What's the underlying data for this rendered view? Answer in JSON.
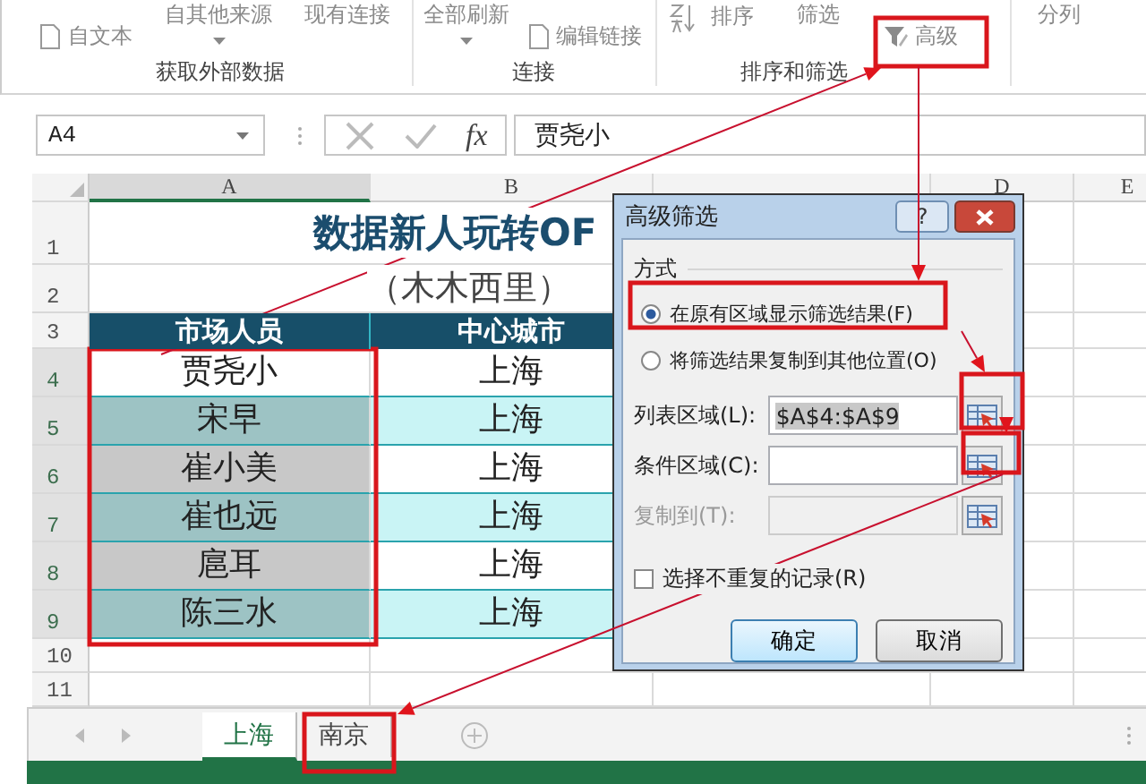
{
  "ribbon": {
    "groups": [
      {
        "label": "获取外部数据",
        "commands": [
          {
            "label": "自文本",
            "kind": "small"
          },
          {
            "label": "自其他来源",
            "kind": "large",
            "dropdown": true
          },
          {
            "label": "现有连接",
            "kind": "large",
            "dropdown": false
          }
        ]
      },
      {
        "label": "连接",
        "commands": [
          {
            "label": "全部刷新",
            "kind": "large",
            "dropdown": true
          },
          {
            "label": "编辑链接",
            "kind": "small"
          }
        ]
      },
      {
        "label": "排序和筛选",
        "commands": [
          {
            "label": "排序",
            "kind": "sort"
          },
          {
            "label": "筛选",
            "kind": "large",
            "dropdown": false
          },
          {
            "label": "高级",
            "kind": "small"
          }
        ]
      },
      {
        "commands": [
          {
            "label": "分列",
            "kind": "large",
            "dropdown": false
          }
        ]
      }
    ]
  },
  "formula_bar": {
    "name_box": "A4",
    "function_label": "fx",
    "formula": "贾尧小"
  },
  "columns": [
    {
      "label": "A",
      "selected": true
    },
    {
      "label": "B",
      "selected": false
    },
    {
      "label": "D",
      "selected": false
    },
    {
      "label": "E",
      "selected": false
    }
  ],
  "title_row": {
    "number": "1",
    "text": "数据新人玩转OF"
  },
  "subtitle_row": {
    "number": "2",
    "text": "（木木西里）"
  },
  "header_row": {
    "number": "3",
    "cells": [
      "市场人员",
      "中心城市"
    ]
  },
  "rows": [
    {
      "number": "4",
      "name": "贾尧小",
      "city": "上海",
      "selected": true,
      "active": true,
      "banded": false
    },
    {
      "number": "5",
      "name": "宋早",
      "city": "上海",
      "selected": true,
      "active": false,
      "banded": true
    },
    {
      "number": "6",
      "name": "崔小美",
      "city": "上海",
      "selected": true,
      "active": false,
      "banded": false
    },
    {
      "number": "7",
      "name": "崔也远",
      "city": "上海",
      "selected": true,
      "active": false,
      "banded": true
    },
    {
      "number": "8",
      "name": "扈耳",
      "city": "上海",
      "selected": true,
      "active": false,
      "banded": false
    },
    {
      "number": "9",
      "name": "陈三水",
      "city": "上海",
      "selected": true,
      "active": false,
      "banded": true
    }
  ],
  "empty_rows": [
    "10",
    "11"
  ],
  "sheet_tabs": [
    {
      "label": "上海",
      "selected": true
    },
    {
      "label": "南京",
      "selected": false
    }
  ],
  "dialog": {
    "title": "高级筛选",
    "help": "?",
    "section": "方式",
    "options": [
      {
        "label": "在原有区域显示筛选结果(F)",
        "selected": true
      },
      {
        "label": "将筛选结果复制到其他位置(O)",
        "selected": false
      }
    ],
    "fields": [
      {
        "label": "列表区域(L):",
        "value": "$A$4:$A$9",
        "disabled": false
      },
      {
        "label": "条件区域(C):",
        "disabled": false
      },
      {
        "label": "复制到(T):",
        "disabled": true
      }
    ],
    "checkbox": {
      "label": "选择不重复的记录(R)",
      "checked": false
    },
    "buttons": [
      "确定",
      "取消"
    ]
  }
}
